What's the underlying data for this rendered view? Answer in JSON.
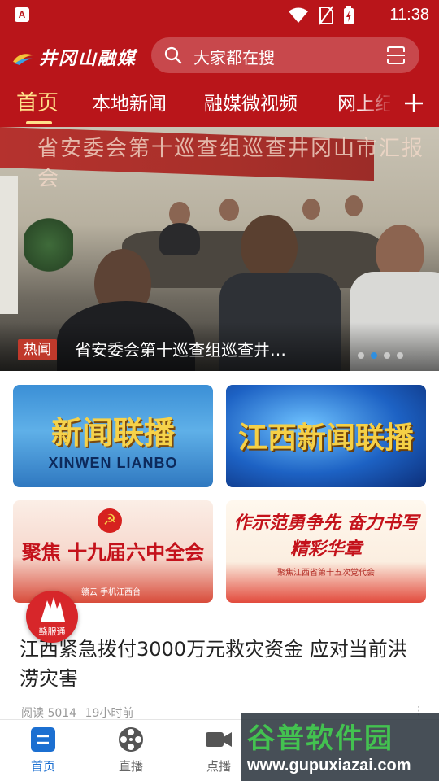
{
  "status_bar": {
    "time": "11:38",
    "app_badge": "A"
  },
  "header": {
    "logo_text": "井冈山融媒",
    "search_placeholder": "大家都在搜"
  },
  "tabs": [
    "首页",
    "本地新闻",
    "融媒微视频",
    "网上纪"
  ],
  "banner": {
    "tag": "热闻",
    "caption": "省安委会第十巡查组巡查井…",
    "backdrop_text": "省安委会第十巡查组巡查井冈山市汇报会",
    "slide_count": 4,
    "active_slide": 2
  },
  "cards": [
    {
      "title": "新闻联播",
      "subtitle": "XINWEN LIANBO"
    },
    {
      "title": "江西新闻联播"
    },
    {
      "title": "聚焦 十九届六中全会",
      "footer": "赣云  手机江西台"
    },
    {
      "title": "作示范勇争先 奋力书写精彩华章",
      "subtitle": "聚焦江西省第十五次党代会"
    }
  ],
  "fab": {
    "label": "赣服通"
  },
  "news": {
    "title": "江西紧急拨付3000万元救灾资金 应对当前洪涝灾害",
    "reads": "阅读 5014",
    "time": "19小时前",
    "more": "⋮"
  },
  "bottom_nav": [
    {
      "label": "首页",
      "icon": "home-icon",
      "active": true
    },
    {
      "label": "直播",
      "icon": "film-reel-icon",
      "active": false
    },
    {
      "label": "点播",
      "icon": "video-camera-icon",
      "active": false
    }
  ],
  "watermark": {
    "title": "谷普软件园",
    "url": "www.gupuxiazai.com"
  },
  "colors": {
    "brand_red": "#b9151a",
    "active_tab": "#ffe08a",
    "nav_active": "#1b6fd1",
    "hot_tag": "#c0392b"
  }
}
